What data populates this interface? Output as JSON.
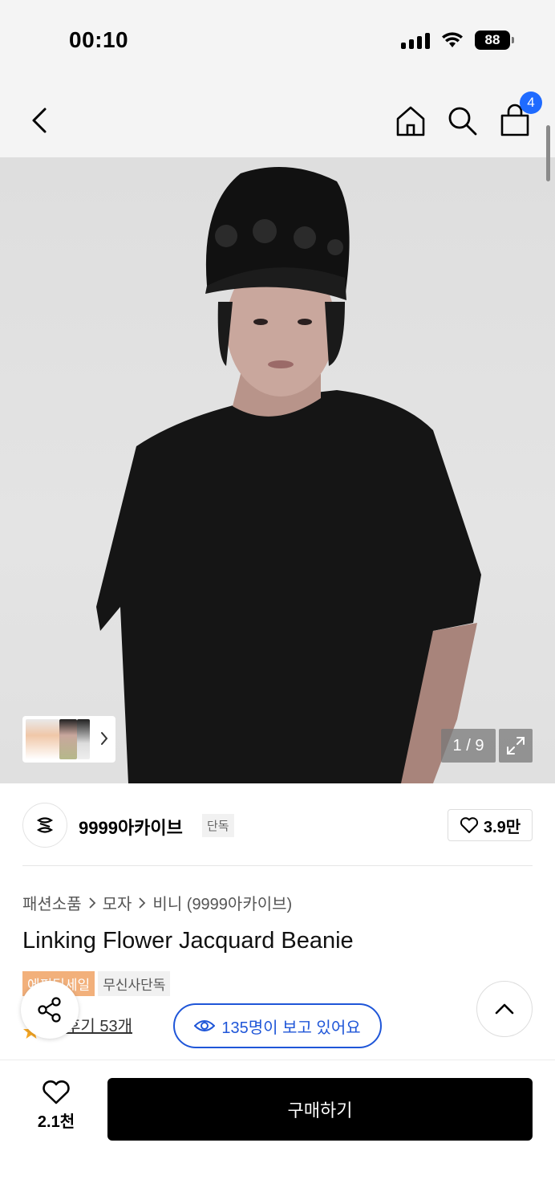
{
  "status_bar": {
    "time": "00:10",
    "battery": "88"
  },
  "nav": {
    "cart_count": "4"
  },
  "gallery": {
    "page_indicator": "1 / 9"
  },
  "brand": {
    "name": "9999아카이브",
    "tag": "단독",
    "like_count": "3.9만"
  },
  "breadcrumb": [
    "패션소품",
    "모자",
    "비니 (9999아카이브)"
  ],
  "product": {
    "title": "Linking Flower Jacquard Beanie",
    "badges": [
      "에픽딜세일",
      "무신사단독"
    ],
    "review_label": "후기 53개",
    "viewers": "135명이 보고 있어요"
  },
  "bottom_bar": {
    "wish_count": "2.1천",
    "buy_label": "구매하기"
  },
  "colors": {
    "accent_blue": "#1f56d8",
    "badge_blue": "#1f6bff",
    "sale_badge": "#f2b07b",
    "review_star": "#f5a623"
  },
  "icons": [
    "back-icon",
    "home-icon",
    "search-icon",
    "cart-icon",
    "chevron-right-icon",
    "expand-icon",
    "heart-icon",
    "eye-icon",
    "star-icon",
    "share-icon",
    "chevron-up-icon"
  ]
}
